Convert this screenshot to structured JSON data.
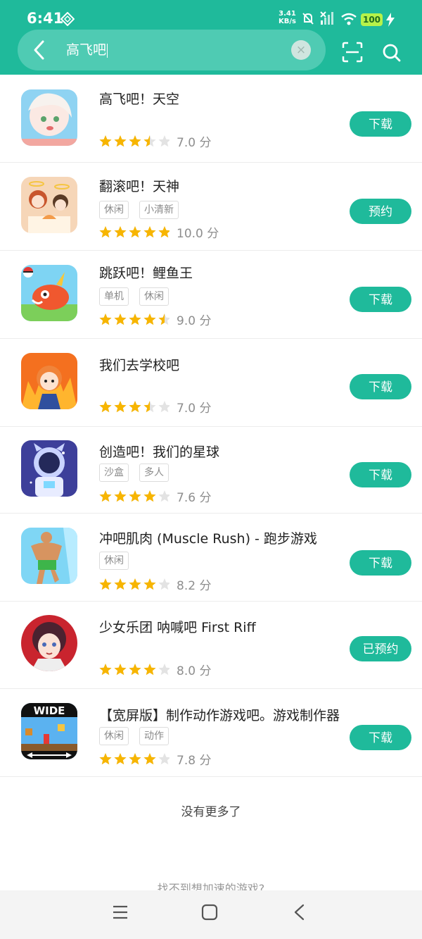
{
  "status_bar": {
    "time": "6:41",
    "net_speed_value": "3.41",
    "net_speed_unit": "KB/s",
    "battery": "100"
  },
  "search": {
    "query": "高飞吧",
    "clear_glyph": "×"
  },
  "rating_suffix": "分",
  "apps": [
    {
      "title": "高飞吧！天空",
      "tags": [],
      "rating": 3.5,
      "score": "7.0",
      "action": "下载",
      "icon": "anime-girl-icon"
    },
    {
      "title": "翻滚吧！天神",
      "tags": [
        "休闲",
        "小清新"
      ],
      "rating": 5,
      "score": "10.0",
      "action": "预约",
      "icon": "angels-cooking-icon"
    },
    {
      "title": "跳跃吧！鲤鱼王",
      "tags": [
        "单机",
        "休闲"
      ],
      "rating": 4.5,
      "score": "9.0",
      "action": "下载",
      "icon": "magikarp-icon"
    },
    {
      "title": "我们去学校吧",
      "tags": [],
      "rating": 3.5,
      "score": "7.0",
      "action": "下载",
      "icon": "fire-girl-icon"
    },
    {
      "title": "创造吧！我们的星球",
      "tags": [
        "沙盒",
        "多人"
      ],
      "rating": 4,
      "score": "7.6",
      "action": "下载",
      "icon": "astronaut-cat-icon"
    },
    {
      "title": "冲吧肌肉 (Muscle Rush) - 跑步游戏",
      "tags": [
        "休闲"
      ],
      "rating": 4,
      "score": "8.2",
      "action": "下载",
      "icon": "muscle-man-icon"
    },
    {
      "title": "少女乐团 呐喊吧 First Riff",
      "tags": [],
      "rating": 4,
      "score": "8.0",
      "action": "已预约",
      "icon": "band-girl-icon"
    },
    {
      "title": "【宽屏版】制作动作游戏吧。游戏制作器",
      "tags": [
        "休闲",
        "动作"
      ],
      "rating": 4,
      "score": "7.8",
      "action": "下载",
      "icon": "wide-game-maker-icon",
      "icon_text": "WIDE"
    }
  ],
  "footer": {
    "no_more": "没有更多了",
    "not_found": "找不到想加速的游戏?"
  },
  "colors": {
    "brand": "#1fba9b",
    "star": "#f7b500",
    "star_empty": "#e3e3e3"
  }
}
